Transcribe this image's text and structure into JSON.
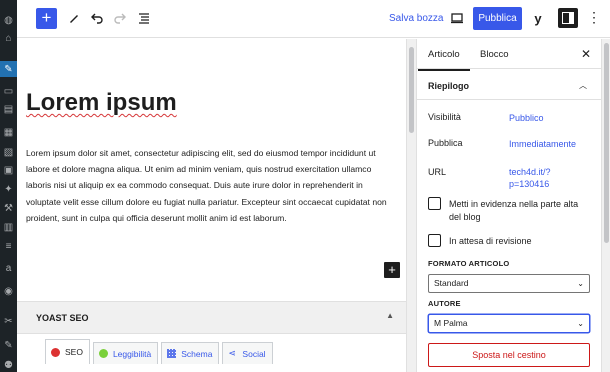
{
  "toolbar": {
    "add_icon": "plus-icon",
    "save_draft": "Salva bozza",
    "publish": "Pubblica",
    "yoast_label": "y",
    "more": "⋮"
  },
  "post": {
    "title": "Lorem ipsum",
    "body": "Lorem ipsum dolor sit amet, consectetur adipiscing elit, sed do eiusmod tempor incididunt ut labore et dolore magna aliqua. Ut enim ad minim veniam, quis nostrud exercitation ullamco laboris nisi ut aliquip ex ea commodo consequat. Duis aute irure dolor in reprehenderit in voluptate velit esse cillum dolore eu fugiat nulla pariatur. Excepteur sint occaecat cupidatat non proident, sunt in culpa qui officia deserunt mollit anim id est laborum."
  },
  "metabox": {
    "title": "YOAST SEO",
    "tabs": [
      {
        "label": "SEO",
        "color": "#dc3232"
      },
      {
        "label": "Leggibilità",
        "color": "#7ad03a"
      },
      {
        "label": "Schema"
      },
      {
        "label": "Social"
      }
    ]
  },
  "sidebar": {
    "tabs": [
      "Articolo",
      "Blocco"
    ],
    "panel_title": "Riepilogo",
    "rows": [
      {
        "label": "Visibilità",
        "value": "Pubblico"
      },
      {
        "label": "Pubblica",
        "value": "Immediatamente"
      },
      {
        "label": "URL",
        "value_line1": "tech4d.it/?",
        "value_line2": "p=130416"
      }
    ],
    "sticky": "Metti in evidenza nella parte alta del blog",
    "pending": "In attesa di revisione",
    "format_caption": "FORMATO ARTICOLO",
    "format_value": "Standard",
    "author_caption": "AUTORE",
    "author_value": "M Palma",
    "trash": "Sposta nel cestino"
  },
  "colors": {
    "accent": "#3858e9",
    "admin_bar": "#1d2327",
    "danger": "#cc1818"
  }
}
